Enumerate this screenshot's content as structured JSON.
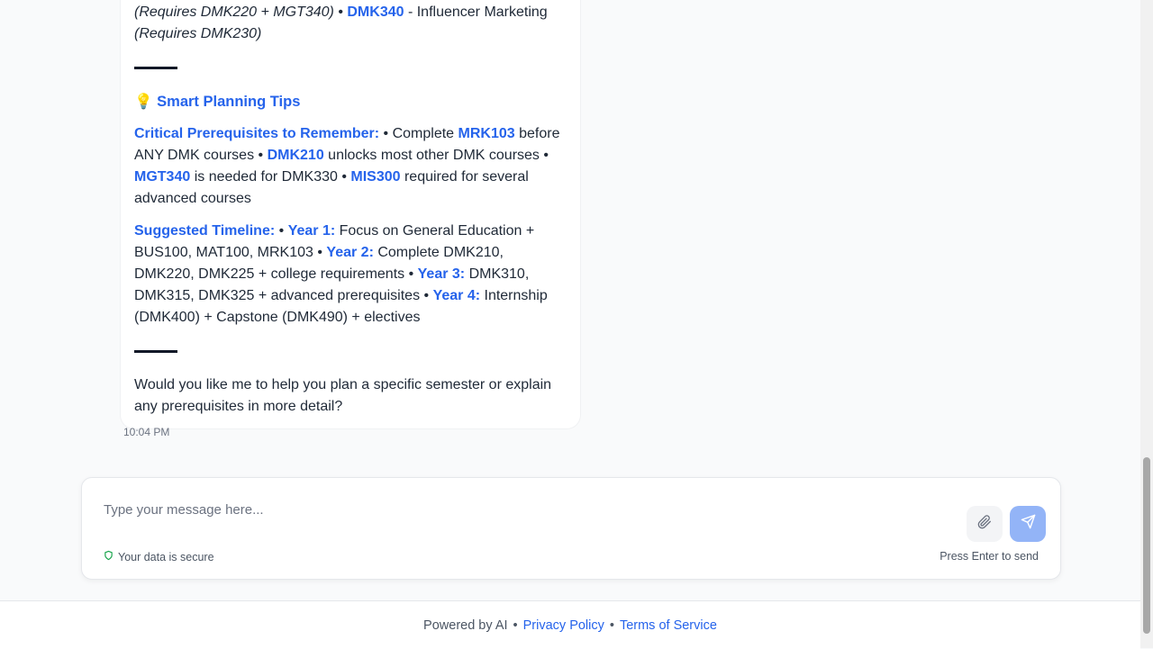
{
  "message": {
    "line1_pre_italic": "(Requires DMK220 + MGT340)",
    "bullet": "•",
    "course_dmk340": "DMK340",
    "dmk340_title": " - Influencer Marketing ",
    "dmk340_req": "(Requires DMK230)",
    "tips_emoji": "💡",
    "tips_heading": "Smart Planning Tips",
    "critical_label": "Critical Prerequisites to Remember:",
    "critical_t1": " • Complete ",
    "critical_c1": "MRK103",
    "critical_t2": " before ANY DMK courses • ",
    "critical_c2": "DMK210",
    "critical_t3": " unlocks most other DMK courses • ",
    "critical_c3": "MGT340",
    "critical_t4": " is needed for DMK330 • ",
    "critical_c4": "MIS300",
    "critical_t5": " required for several advanced courses",
    "timeline_label": "Suggested Timeline:",
    "tl_b1": " • ",
    "year1": "Year 1:",
    "year1_text": " Focus on General Education + BUS100, MAT100, MRK103 • ",
    "year2": "Year 2:",
    "year2_text": " Complete DMK210, DMK220, DMK225 + college requirements • ",
    "year3": "Year 3:",
    "year3_text": " DMK310, DMK315, DMK325 + advanced prerequisites • ",
    "year4": "Year 4:",
    "year4_text": " Internship (DMK400) + Capstone (DMK490) + electives",
    "closing": "Would you like me to help you plan a specific semester or explain any prerequisites in more detail?",
    "timestamp": "10:04 PM"
  },
  "composer": {
    "placeholder": "Type your message here...",
    "secure_text": "Your data is secure",
    "hint": "Press Enter to send",
    "attach_icon": "paperclip-icon",
    "send_icon": "send-icon"
  },
  "footer": {
    "powered": "Powered by AI",
    "sep": "•",
    "privacy": "Privacy Policy",
    "terms": "Terms of Service"
  },
  "colors": {
    "accent": "#2563eb",
    "send_button": "#93b4f7",
    "secure_icon": "#16a34a"
  }
}
